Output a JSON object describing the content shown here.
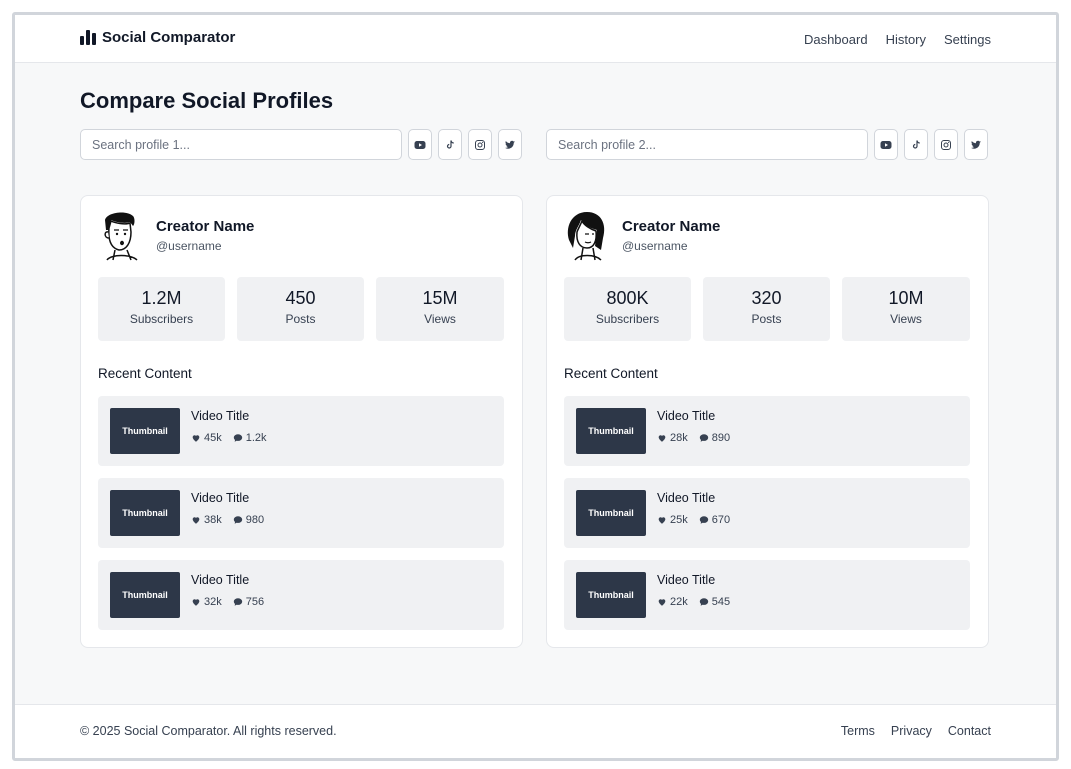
{
  "header": {
    "brand": "Social Comparator",
    "nav": [
      "Dashboard",
      "History",
      "Settings"
    ]
  },
  "page_title": "Compare Social Profiles",
  "search": {
    "profile1_placeholder": "Search profile 1...",
    "profile2_placeholder": "Search profile 2...",
    "platforms": [
      "youtube-icon",
      "tiktok-icon",
      "instagram-icon",
      "twitter-icon"
    ]
  },
  "profiles": [
    {
      "name": "Creator Name",
      "handle": "@username",
      "stats": [
        {
          "value": "1.2M",
          "label": "Subscribers"
        },
        {
          "value": "450",
          "label": "Posts"
        },
        {
          "value": "15M",
          "label": "Views"
        }
      ],
      "recent_title": "Recent Content",
      "content": [
        {
          "thumb": "Thumbnail",
          "title": "Video Title",
          "likes": "45k",
          "comments": "1.2k"
        },
        {
          "thumb": "Thumbnail",
          "title": "Video Title",
          "likes": "38k",
          "comments": "980"
        },
        {
          "thumb": "Thumbnail",
          "title": "Video Title",
          "likes": "32k",
          "comments": "756"
        }
      ]
    },
    {
      "name": "Creator Name",
      "handle": "@username",
      "stats": [
        {
          "value": "800K",
          "label": "Subscribers"
        },
        {
          "value": "320",
          "label": "Posts"
        },
        {
          "value": "10M",
          "label": "Views"
        }
      ],
      "recent_title": "Recent Content",
      "content": [
        {
          "thumb": "Thumbnail",
          "title": "Video Title",
          "likes": "28k",
          "comments": "890"
        },
        {
          "thumb": "Thumbnail",
          "title": "Video Title",
          "likes": "25k",
          "comments": "670"
        },
        {
          "thumb": "Thumbnail",
          "title": "Video Title",
          "likes": "22k",
          "comments": "545"
        }
      ]
    }
  ],
  "footer": {
    "copyright": "© 2025 Social Comparator. All rights reserved.",
    "links": [
      "Terms",
      "Privacy",
      "Contact"
    ]
  }
}
